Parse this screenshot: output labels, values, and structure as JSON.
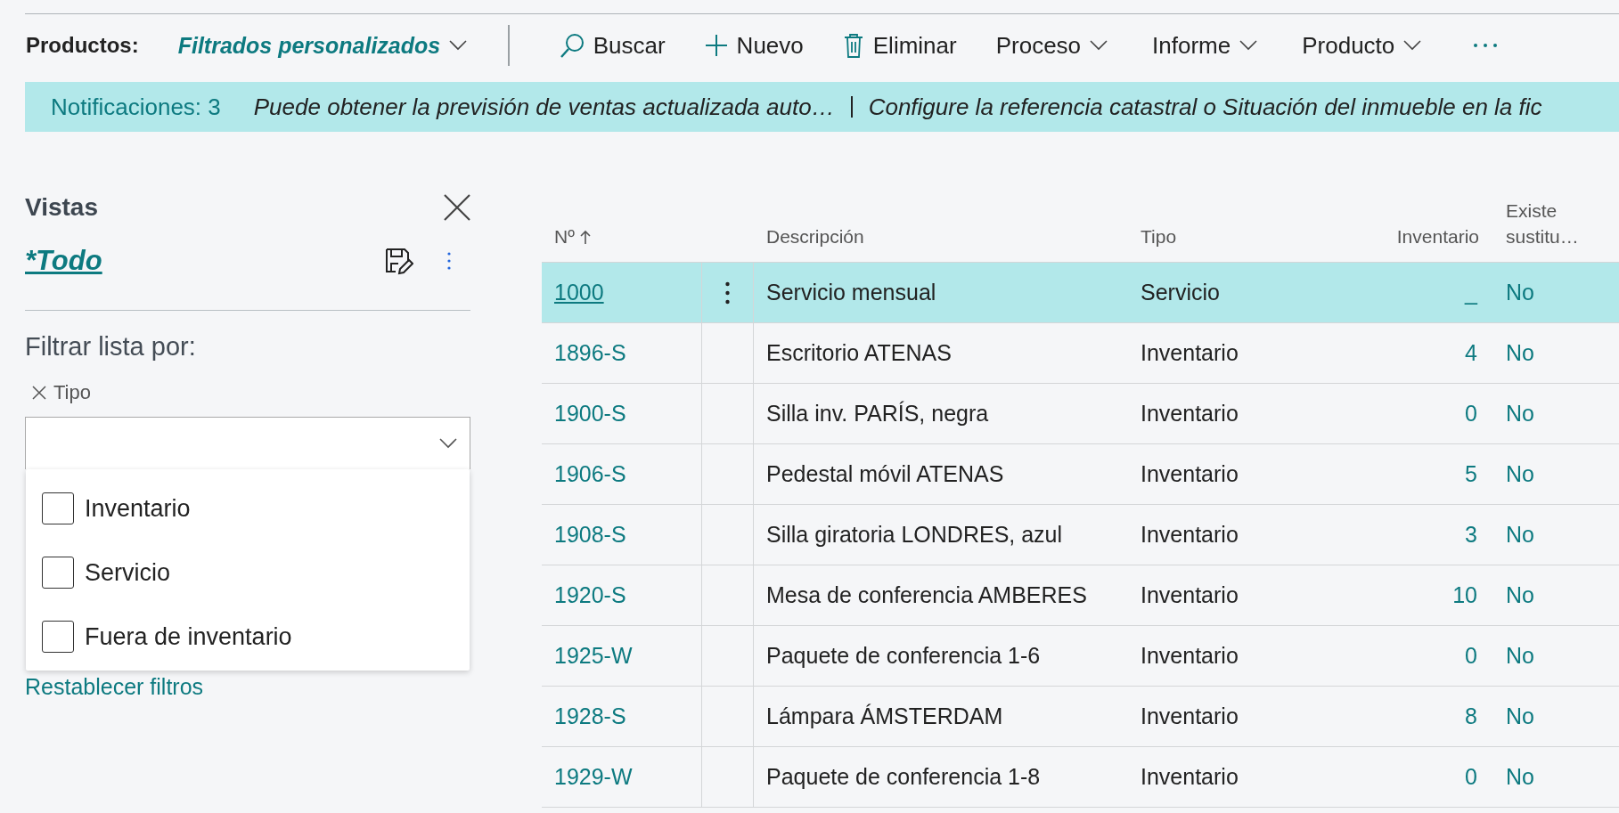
{
  "toolbar": {
    "page_title": "Productos:",
    "view_menu": "Filtrados personalizados",
    "actions": [
      {
        "kind": "action",
        "label": "Buscar"
      },
      {
        "kind": "action",
        "label": "Nuevo"
      },
      {
        "kind": "action",
        "label": "Eliminar"
      },
      {
        "kind": "menu",
        "label": "Proceso"
      },
      {
        "kind": "menu",
        "label": "Informe"
      },
      {
        "kind": "menu",
        "label": "Producto"
      }
    ]
  },
  "notifications": {
    "count_label": "Notificaciones: 3",
    "messages": [
      "Puede obtener la previsión de ventas actualizada auto…",
      "Configure la referencia catastral o Situación del inmueble en la fic"
    ]
  },
  "views_panel": {
    "title": "Vistas",
    "current_view": "*Todo",
    "filter_heading": "Filtrar lista por:",
    "filter_field": {
      "label": "Tipo",
      "options": [
        {
          "label": "Inventario",
          "checked": false
        },
        {
          "label": "Servicio",
          "checked": false
        },
        {
          "label": "Fuera de inventario",
          "checked": false
        }
      ]
    },
    "reset_link": "Restablecer filtros"
  },
  "table": {
    "columns": [
      {
        "label": "Nº",
        "kind": "sorted"
      },
      {
        "label": "Descripción",
        "kind": "text"
      },
      {
        "label": "Tipo",
        "kind": "text"
      },
      {
        "label": "Inventario",
        "kind": "number"
      },
      {
        "label": "Existe sustitu…",
        "kind": "text"
      }
    ],
    "rows": [
      {
        "no": "1000",
        "selected": true,
        "description": "Servicio mensual",
        "type": "Servicio",
        "inventory": "_",
        "substitute": "No"
      },
      {
        "no": "1896-S",
        "selected": false,
        "description": "Escritorio ATENAS",
        "type": "Inventario",
        "inventory": "4",
        "substitute": "No"
      },
      {
        "no": "1900-S",
        "selected": false,
        "description": "Silla inv. PARÍS, negra",
        "type": "Inventario",
        "inventory": "0",
        "substitute": "No"
      },
      {
        "no": "1906-S",
        "selected": false,
        "description": "Pedestal móvil ATENAS",
        "type": "Inventario",
        "inventory": "5",
        "substitute": "No"
      },
      {
        "no": "1908-S",
        "selected": false,
        "description": "Silla giratoria LONDRES, azul",
        "type": "Inventario",
        "inventory": "3",
        "substitute": "No"
      },
      {
        "no": "1920-S",
        "selected": false,
        "description": "Mesa de conferencia AMBERES",
        "type": "Inventario",
        "inventory": "10",
        "substitute": "No"
      },
      {
        "no": "1925-W",
        "selected": false,
        "description": "Paquete de conferencia 1-6",
        "type": "Inventario",
        "inventory": "0",
        "substitute": "No"
      },
      {
        "no": "1928-S",
        "selected": false,
        "description": "Lámpara ÁMSTERDAM",
        "type": "Inventario",
        "inventory": "8",
        "substitute": "No"
      },
      {
        "no": "1929-W",
        "selected": false,
        "description": "Paquete de conferencia 1-8",
        "type": "Inventario",
        "inventory": "0",
        "substitute": "No"
      }
    ]
  }
}
